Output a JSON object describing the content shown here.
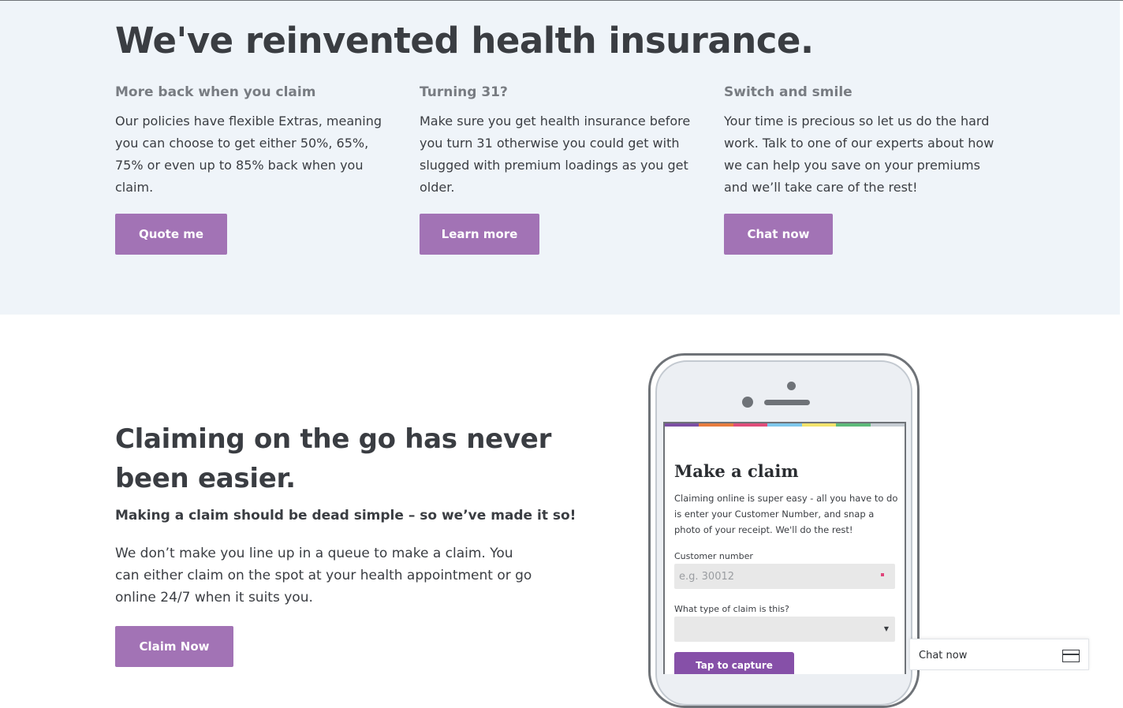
{
  "hero": {
    "title": "We've reinvented health insurance.",
    "features": [
      {
        "heading": "More back when you claim",
        "body": "Our policies have flexible Extras, meaning you can choose to get either 50%, 65%, 75% or even up to 85% back when you claim.",
        "button": "Quote me"
      },
      {
        "heading": "Turning 31?",
        "body": "Make sure you get health insurance before you turn 31 otherwise you could get with slugged with premium loadings as you get older.",
        "button": "Learn more"
      },
      {
        "heading": "Switch and smile",
        "body": "Your time is precious so let us do the hard work. Talk to one of our experts about how we can help you save on your premiums and we’ll take care of the rest!",
        "button": "Chat now"
      }
    ]
  },
  "claims": {
    "title": "Claiming on the go has never been easier.",
    "subtitle": "Making a claim should be dead simple – so we’ve made it so!",
    "body": "We don’t make you line up in a queue to make a claim. You can either claim on the spot at your health appointment or go online 24/7 when it suits you.",
    "button": "Claim Now"
  },
  "phone_screen": {
    "title": "Make a claim",
    "description": "Claiming online is super easy - all you have to do is enter your Customer Number, and snap a photo of your receipt. We'll do the rest!",
    "customer_number_label": "Customer number",
    "customer_number_placeholder": "e.g. 30012",
    "claim_type_label": "What type of claim is this?",
    "claim_type_value": "",
    "capture_button": "Tap to capture",
    "rainbow_colors": [
      "#7c4fa3",
      "#e87c3e",
      "#e04d7a",
      "#7ec8ec",
      "#f2e36b",
      "#5dbb7a",
      "#c6ccd3"
    ]
  },
  "chat_widget": {
    "label": "Chat now",
    "icon": "window-icon"
  },
  "colors": {
    "accent": "#a273b5",
    "hero_background": "#eff4f9",
    "text": "#3a3d42",
    "subheading": "#787c82"
  }
}
